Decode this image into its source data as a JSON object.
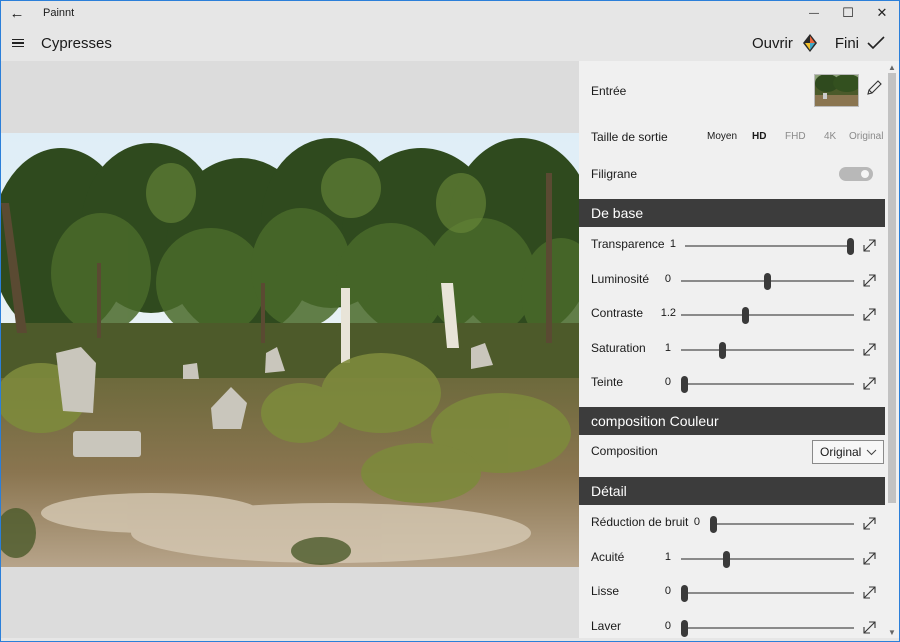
{
  "window": {
    "app_name": "Painnt",
    "document_title": "Cypresses"
  },
  "titlebar": {
    "back_glyph": "←",
    "minimize_glyph": "—",
    "maximize_glyph": "☐",
    "close_glyph": "✕"
  },
  "appbar": {
    "open_label": "Ouvrir",
    "done_label": "Fini"
  },
  "settings": {
    "input_label": "Entrée",
    "output_size_label": "Taille de sortie",
    "output_sizes": [
      "Moyen",
      "HD",
      "FHD",
      "4K",
      "Original"
    ],
    "output_size_selected": "HD",
    "watermark_label": "Filigrane",
    "watermark_on": false
  },
  "sections": {
    "basic": "De base",
    "color_composition": "composition Couleur",
    "detail": "Détail"
  },
  "basic_sliders": [
    {
      "label": "Transparence",
      "value": "1",
      "fraction": 1.0
    },
    {
      "label": "Luminosité",
      "value": "0",
      "fraction": 0.5
    },
    {
      "label": "Contraste",
      "value": "1.2",
      "fraction": 0.37
    },
    {
      "label": "Saturation",
      "value": "1",
      "fraction": 0.23
    },
    {
      "label": "Teinte",
      "value": "0",
      "fraction": 0.0
    }
  ],
  "composition": {
    "label": "Composition",
    "selected": "Original"
  },
  "detail_sliders": [
    {
      "label": "Réduction de bruit",
      "value": "0",
      "fraction": 0.0
    },
    {
      "label": "Acuité",
      "value": "1",
      "fraction": 0.25
    },
    {
      "label": "Lisse",
      "value": "0",
      "fraction": 0.0
    },
    {
      "label": "Laver",
      "value": "0",
      "fraction": 0.0
    }
  ],
  "colors": {
    "section_header": "#3c3c3c",
    "panel_bg": "#f0f0f0",
    "preview_bg": "#dcdcdc",
    "window_border": "#2b7fd9"
  },
  "icons": {
    "back": "back-arrow-icon",
    "menu": "hamburger-menu-icon",
    "open": "painnt-logo-icon",
    "done": "checkmark-icon",
    "edit": "pencil-icon",
    "expand": "expand-arrow-icon",
    "dropdown": "chevron-down-icon"
  }
}
